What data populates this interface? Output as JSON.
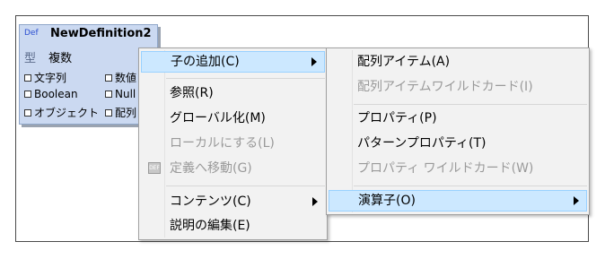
{
  "definition": {
    "badge": "Def",
    "name": "NewDefinition2",
    "type_label": "型",
    "type_value": "複数",
    "checkboxes": [
      {
        "label": "文字列"
      },
      {
        "label": "数値"
      },
      {
        "label": "Boolean"
      },
      {
        "label": "Null"
      },
      {
        "label": "オブジェクト"
      },
      {
        "label": "配列"
      }
    ]
  },
  "context_menu": {
    "items": [
      {
        "label": "子の追加(C)",
        "submenu": true,
        "highlighted": true,
        "enabled": true
      },
      {
        "label": "参照(R)",
        "enabled": true
      },
      {
        "label": "グローバル化(M)",
        "enabled": true
      },
      {
        "label": "ローカルにする(L)",
        "enabled": false
      },
      {
        "label": "定義へ移動(G)",
        "enabled": false,
        "icon": "definition-icon"
      },
      {
        "label": "コンテンツ(C)",
        "submenu": true,
        "enabled": true
      },
      {
        "label": "説明の編集(E)",
        "enabled": true
      }
    ],
    "def_icon_text": "DEF"
  },
  "add_child_submenu": {
    "items": [
      {
        "label": "配列アイテム(A)",
        "enabled": true
      },
      {
        "label": "配列アイテムワイルドカード(I)",
        "enabled": false
      },
      {
        "label": "プロパティ(P)",
        "enabled": true
      },
      {
        "label": "パターンプロパティ(T)",
        "enabled": true
      },
      {
        "label": "プロパティ ワイルドカード(W)",
        "enabled": false
      },
      {
        "label": "演算子(O)",
        "submenu": true,
        "highlighted": true,
        "enabled": true
      }
    ]
  }
}
